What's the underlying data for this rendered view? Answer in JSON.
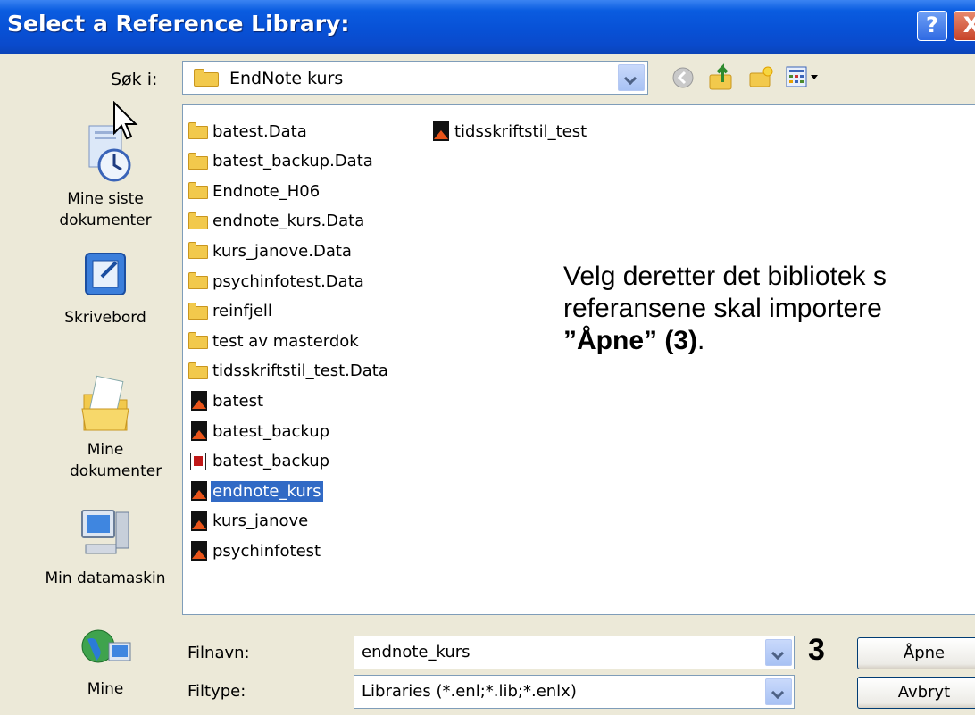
{
  "window": {
    "title": "Select a Reference Library:",
    "help_label": "?",
    "close_label": "X"
  },
  "toolbar": {
    "look_in_label": "Søk i:",
    "look_in_value": "EndNote kurs"
  },
  "places": [
    {
      "label": "Mine siste dokumenter",
      "icon": "recent-documents-icon"
    },
    {
      "label": "Skrivebord",
      "icon": "desktop-icon"
    },
    {
      "label": "Mine dokumenter",
      "icon": "my-documents-icon"
    },
    {
      "label": "Min datamaskin",
      "icon": "my-computer-icon"
    },
    {
      "label": "Mine",
      "icon": "network-places-icon"
    }
  ],
  "files": {
    "column1": [
      {
        "name": "batest.Data",
        "type": "folder"
      },
      {
        "name": "batest_backup.Data",
        "type": "folder"
      },
      {
        "name": "Endnote_H06",
        "type": "folder"
      },
      {
        "name": "endnote_kurs.Data",
        "type": "folder"
      },
      {
        "name": "kurs_janove.Data",
        "type": "folder"
      },
      {
        "name": "psychinfotest.Data",
        "type": "folder"
      },
      {
        "name": "reinfjell",
        "type": "folder"
      },
      {
        "name": "test av masterdok",
        "type": "folder"
      },
      {
        "name": "tidsskriftstil_test.Data",
        "type": "folder"
      },
      {
        "name": "batest",
        "type": "library"
      },
      {
        "name": "batest_backup",
        "type": "library"
      },
      {
        "name": "batest_backup",
        "type": "library-compressed"
      },
      {
        "name": "endnote_kurs",
        "type": "library",
        "selected": true
      },
      {
        "name": "kurs_janove",
        "type": "library"
      },
      {
        "name": "psychinfotest",
        "type": "library"
      }
    ],
    "column2": [
      {
        "name": "tidsskriftstil_test",
        "type": "library"
      }
    ]
  },
  "instruction": {
    "line1": "Velg deretter det bibliotek s",
    "line2": "referansene skal importere",
    "line3_bold": "”Åpne” (3)",
    "line3_rest": "."
  },
  "filename": {
    "label": "Filnavn:",
    "value": "endnote_kurs"
  },
  "filetype": {
    "label": "Filtype:",
    "value": "Libraries (*.enl;*.lib;*.enlx)"
  },
  "step_number": "3",
  "buttons": {
    "open_label": "Åpne",
    "cancel_label": "Avbryt"
  }
}
